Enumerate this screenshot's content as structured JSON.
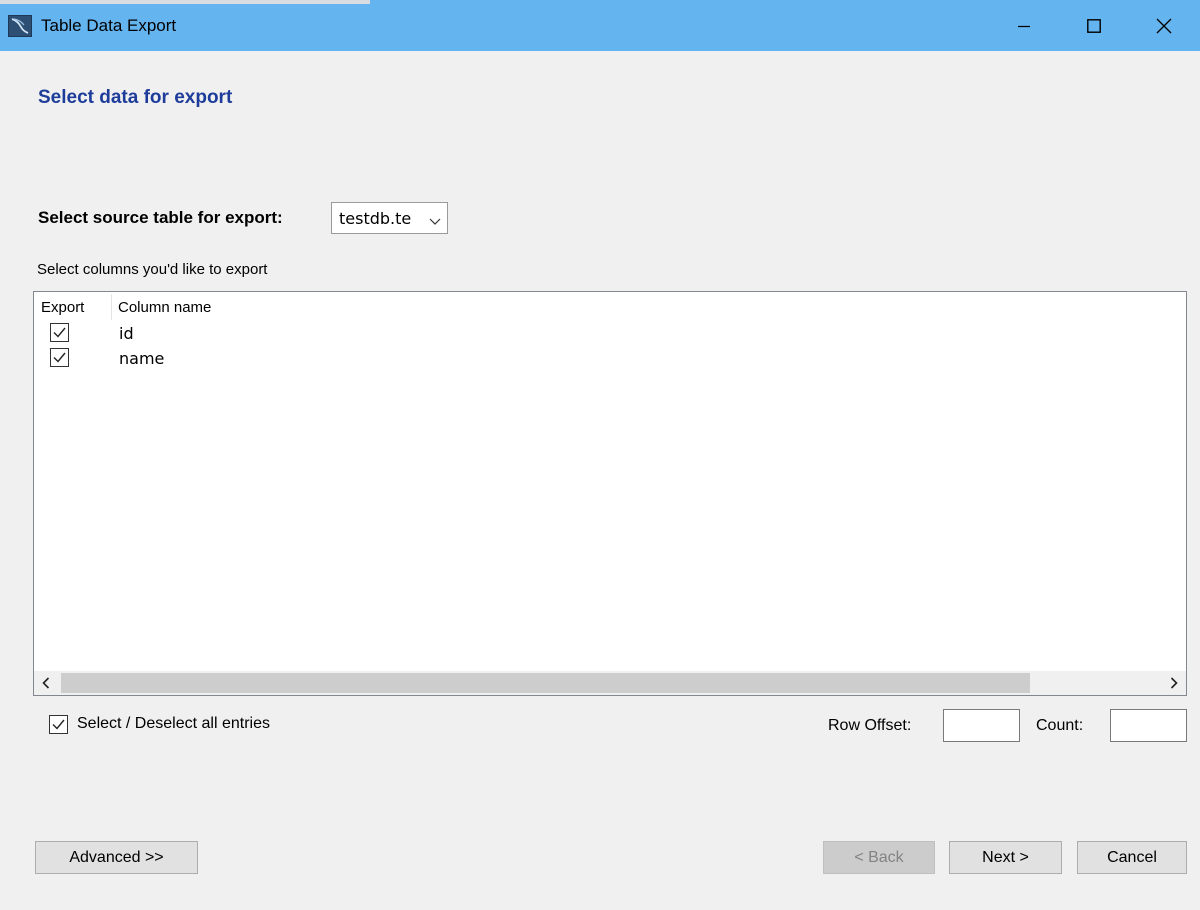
{
  "window": {
    "title": "Table Data Export",
    "controls": [
      "minimize-icon",
      "maximize-icon",
      "close-icon"
    ],
    "titlebar_color": "#64b4f0"
  },
  "page": {
    "heading": "Select data for export",
    "heading_color": "#1e3d9a"
  },
  "source": {
    "label": "Select source table for export:",
    "selected": "testdb.te"
  },
  "columns": {
    "prompt": "Select columns you'd like to export",
    "headers": {
      "export": "Export",
      "name": "Column name"
    },
    "rows": [
      {
        "checked": true,
        "name": "id"
      },
      {
        "checked": true,
        "name": "name"
      }
    ]
  },
  "options": {
    "select_all_label": "Select / Deselect all entries",
    "select_all_checked": true,
    "row_offset_label": "Row Offset:",
    "row_offset_value": "",
    "count_label": "Count:",
    "count_value": ""
  },
  "buttons": {
    "advanced": "Advanced >>",
    "back": "< Back",
    "back_enabled": false,
    "next": "Next >",
    "cancel": "Cancel"
  }
}
